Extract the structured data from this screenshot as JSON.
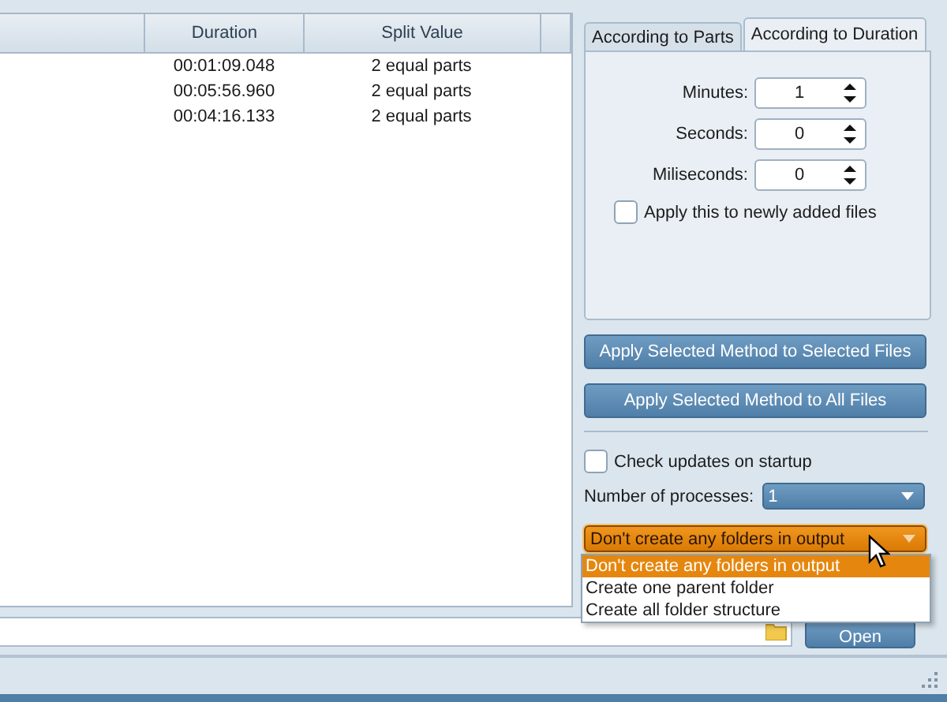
{
  "table": {
    "columns": [
      "Duration",
      "Split Value"
    ],
    "rows": [
      {
        "duration": "00:01:09.048",
        "split_value": "2 equal parts"
      },
      {
        "duration": "00:05:56.960",
        "split_value": "2 equal parts"
      },
      {
        "duration": "00:04:16.133",
        "split_value": "2 equal parts"
      }
    ]
  },
  "tabs": [
    {
      "label": "According to Parts",
      "selected": false
    },
    {
      "label": "According to Duration",
      "selected": true
    }
  ],
  "spinners": [
    {
      "label": "Minutes:",
      "value": "1"
    },
    {
      "label": "Seconds:",
      "value": "0"
    },
    {
      "label": "Miliseconds:",
      "value": "0"
    }
  ],
  "apply_new": {
    "label": "Apply this to newly added files",
    "checked": false
  },
  "buttons": [
    "Apply Selected Method to Selected Files",
    "Apply Selected Method to All Files"
  ],
  "check_updates": {
    "label": "Check updates on startup",
    "checked": false
  },
  "processes": {
    "label": "Number of processes:",
    "value": "1"
  },
  "folders": {
    "value": "Don't create any folders in output",
    "expanded": true,
    "options": [
      {
        "label": "Don't create any folders in output",
        "selected": true
      },
      {
        "label": "Create one parent folder",
        "selected": false
      },
      {
        "label": "Create all folder structure",
        "selected": false
      }
    ]
  },
  "open_button": "Open"
}
